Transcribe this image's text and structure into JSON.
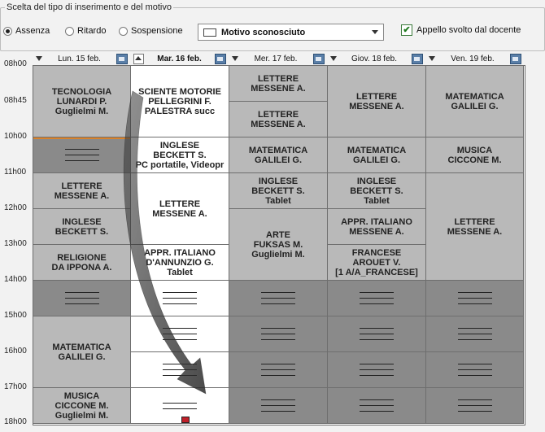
{
  "section_title": "Scelta del tipo di inserimento e del motivo",
  "radios": [
    {
      "label": "Assenza",
      "selected": true
    },
    {
      "label": "Ritardo",
      "selected": false
    },
    {
      "label": "Sospensione",
      "selected": false
    }
  ],
  "motivo_dropdown": {
    "value": "Motivo sconosciuto"
  },
  "appello_checkbox": {
    "label": "Appello svolto dal docente",
    "checked": true
  },
  "times": [
    "08h00",
    "08h45",
    "10h00",
    "11h00",
    "12h00",
    "13h00",
    "14h00",
    "15h00",
    "16h00",
    "17h00",
    "18h00"
  ],
  "days": [
    "Lun. 15 feb.",
    "Mar. 16 feb.",
    "Mer. 17 feb.",
    "Giov. 18 feb.",
    "Ven. 19 feb."
  ],
  "lessons": {
    "lun_tec": [
      "TECNOLOGIA",
      "LUNARDI P.",
      "Guglielmi M."
    ],
    "lun_let": [
      "LETTERE",
      "MESSENE A."
    ],
    "lun_ing": [
      "INGLESE",
      "BECKETT S."
    ],
    "lun_rel": [
      "RELIGIONE",
      "DA IPPONA A."
    ],
    "lun_mat": [
      "MATEMATICA",
      "GALILEI G."
    ],
    "lun_mus": [
      "MUSICA",
      "CICCONE M.",
      "Guglielmi M."
    ],
    "mar_sci": [
      "SCIENTE MOTORIE",
      "PELLEGRINI F.",
      "PALESTRA succ"
    ],
    "mar_ing": [
      "INGLESE",
      "BECKETT S.",
      "PC portatile, Videopr"
    ],
    "mar_let": [
      "LETTERE",
      "MESSENE A."
    ],
    "mar_app": [
      "APPR. ITALIANO",
      "D'ANNUNZIO G.",
      "Tablet"
    ],
    "mer_let1": [
      "LETTERE",
      "MESSENE A."
    ],
    "mer_let2": [
      "LETTERE",
      "MESSENE A."
    ],
    "mer_mat": [
      "MATEMATICA",
      "GALILEI G."
    ],
    "mer_ing": [
      "INGLESE",
      "BECKETT S.",
      "Tablet"
    ],
    "mer_art": [
      "ARTE",
      "FUKSAS M.",
      "Guglielmi M."
    ],
    "gio_let": [
      "LETTERE",
      "MESSENE A."
    ],
    "gio_mat": [
      "MATEMATICA",
      "GALILEI G."
    ],
    "gio_ing": [
      "INGLESE",
      "BECKETT S.",
      "Tablet"
    ],
    "gio_app": [
      "APPR. ITALIANO",
      "MESSENE A."
    ],
    "gio_fra": [
      "FRANCESE",
      "AROUET V.",
      "[1 A/A_FRANCESE]"
    ],
    "ven_mat": [
      "MATEMATICA",
      "GALILEI G."
    ],
    "ven_mus": [
      "MUSICA",
      "CICCONE M."
    ],
    "ven_let": [
      "LETTERE",
      "MESSENE A."
    ]
  }
}
